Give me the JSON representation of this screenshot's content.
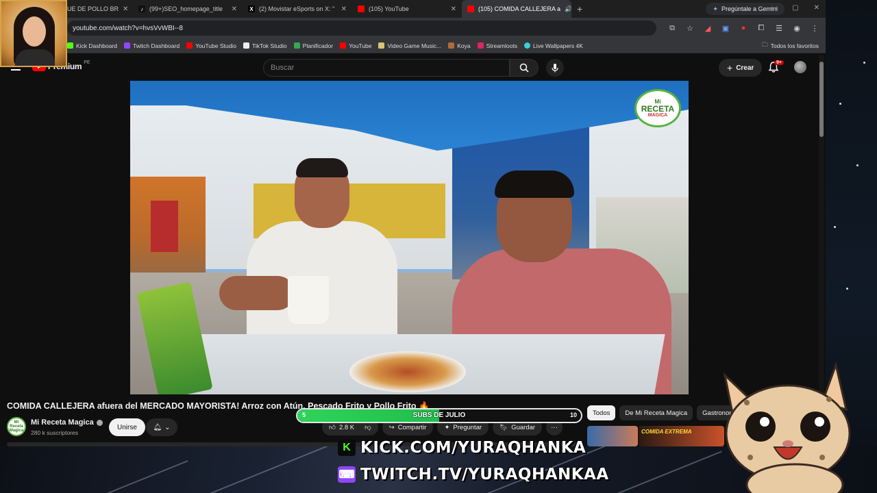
{
  "browser": {
    "tabs": [
      {
        "label": "UE DE POLLO BR",
        "favicon": "icon",
        "active": false
      },
      {
        "label": "(99+)SEO_homepage_title",
        "favicon": "tiktok-icon",
        "active": false
      },
      {
        "label": "(2) Movistar eSports on X: \"",
        "favicon": "x-icon",
        "active": false
      },
      {
        "label": "(105) YouTube",
        "favicon": "youtube-icon",
        "active": false
      },
      {
        "label": "(105) COMIDA CALLEJERA a",
        "favicon": "youtube-icon",
        "active": true
      }
    ],
    "gemini_label": "Pregúntale a Gemini",
    "url": "youtube.com/watch?v=hvsVvWBI--8",
    "bookmarks": [
      {
        "label": "Kick Dashboard",
        "color": "#53fc18"
      },
      {
        "label": "Twitch Dashboard",
        "color": "#9146ff"
      },
      {
        "label": "YouTube Studio",
        "color": "#ff0000"
      },
      {
        "label": "TikTok Studio",
        "color": "#eeeeee"
      },
      {
        "label": "Planificador",
        "color": "#34a853"
      },
      {
        "label": "YouTube",
        "color": "#ff0000"
      },
      {
        "label": "Video Game Music...",
        "color": "#d9c27a"
      },
      {
        "label": "Koya",
        "color": "#b06a3a"
      },
      {
        "label": "Streamloots",
        "color": "#e0245e"
      },
      {
        "label": "Live Wallpapers 4K",
        "color": "#3ecfd6"
      }
    ],
    "favorites_label": "Todos los favoritos"
  },
  "youtube": {
    "logo_text": "Premium",
    "country_code": "PE",
    "search_placeholder": "Buscar",
    "create_label": "Crear",
    "notification_count": "9+",
    "video_badge": {
      "line1": "Mi",
      "line2": "RECETA",
      "line3": "MAGICA"
    },
    "video_title": "COMIDA CALLEJERA afuera del MERCADO MAYORISTA! Arroz con Atún, Pescado Frito y Pollo Frito 🔥",
    "channel_name": "Mi Receta Magica",
    "channel_avatar_text": "Mi Receta Magica",
    "subscribers": "280 k suscriptores",
    "join_label": "Unirse",
    "likes": "2.8 K",
    "share_label": "Compartir",
    "ask_label": "Preguntar",
    "save_label": "Guardar",
    "chips": [
      {
        "label": "Todos",
        "active": true
      },
      {
        "label": "De Mi Receta Magica",
        "active": false
      },
      {
        "label": "Gastronomía",
        "active": false
      }
    ],
    "recommended_thumb_text": "COMIDA EXTREMA"
  },
  "overlay": {
    "subgoal": {
      "label": "SUBS DE JULIO",
      "current": 5,
      "goal": 10
    },
    "kick_text": "KICK.COM/YURAQHANKA",
    "twitch_text": "TWITCH.TV/YURAQHANKAA",
    "kick_color": "#53fc18",
    "twitch_color": "#9146ff"
  }
}
